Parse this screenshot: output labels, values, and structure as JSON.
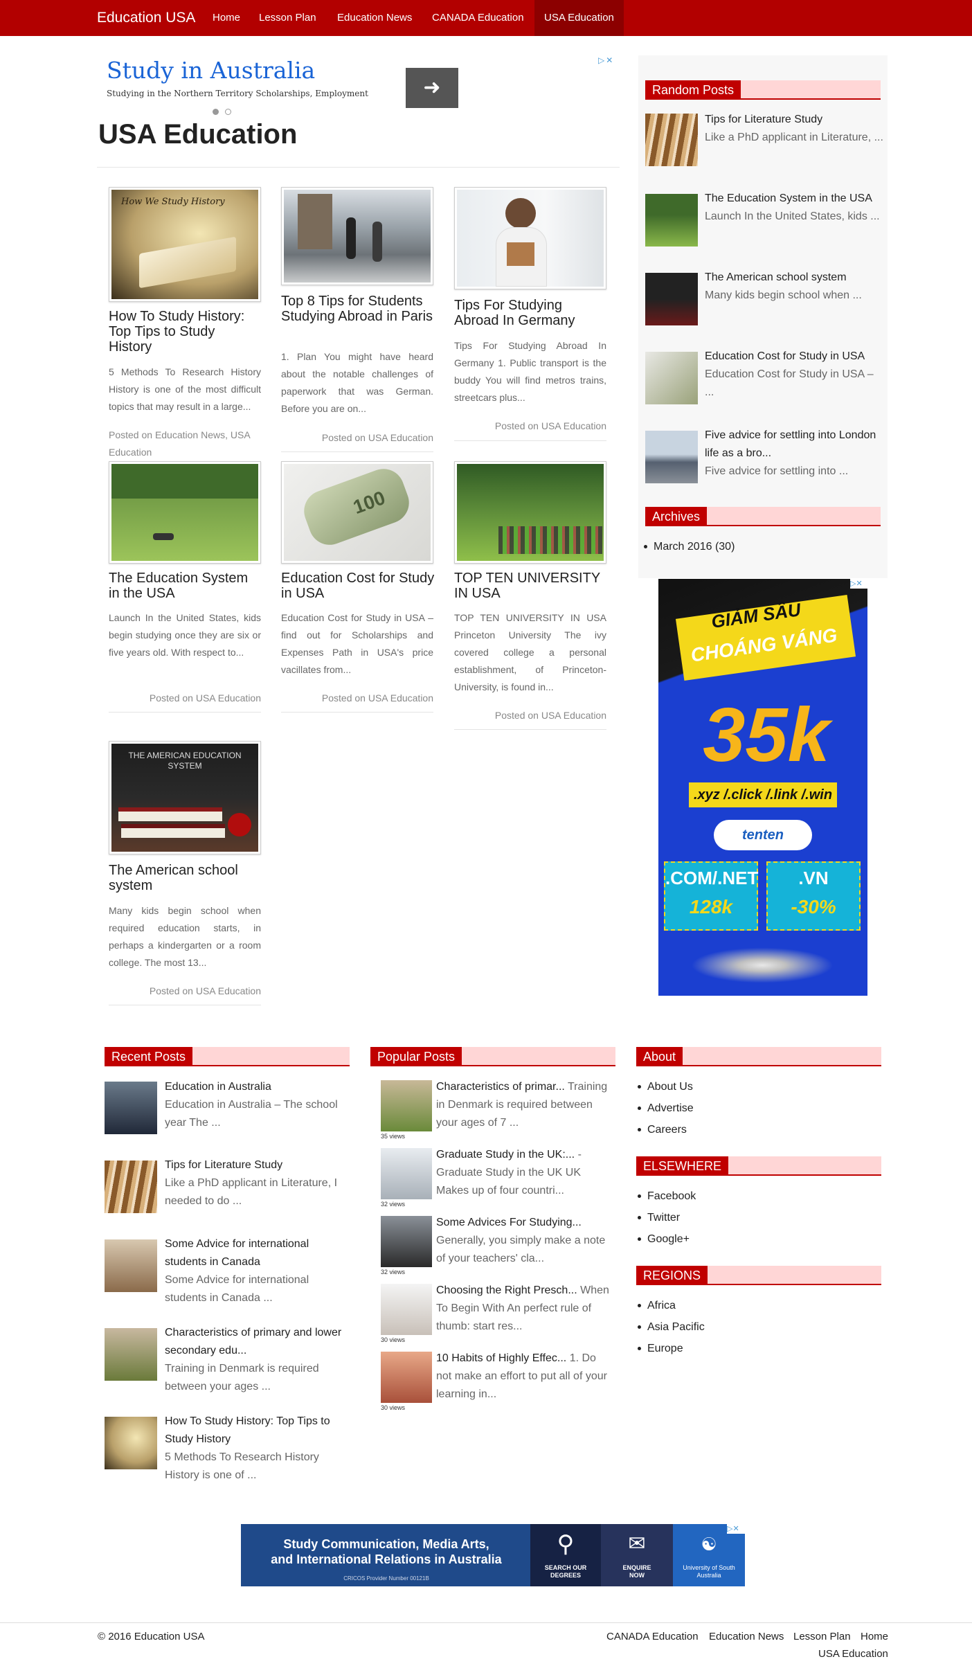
{
  "nav": {
    "brand": "Education USA",
    "items": [
      "Home",
      "Lesson Plan",
      "Education News",
      "CANADA Education",
      "USA Education"
    ],
    "active_index": 4
  },
  "ad_top": {
    "title": "Study in Australia",
    "subtitle": "Studying in the Northern Territory Scholarships, Employment",
    "button_icon": "arrow-right-icon",
    "adchoices_icon": "adchoices-close-icon"
  },
  "page_title": "USA Education",
  "posts": [
    {
      "title": "How To Study History: Top Tips to Study History",
      "excerpt": "5 Methods To Research History History is one of the most difficult topics that may result in a large...",
      "meta": "Posted on Education News, USA Education",
      "thumb_caption": "How We Study History"
    },
    {
      "title": "Top 8 Tips for Students Studying Abroad in Paris",
      "excerpt": "1. Plan You might have heard about the notable challenges of paperwork that was German. Before you are on...",
      "meta": "Posted on USA Education"
    },
    {
      "title": "Tips For Studying Abroad In Germany",
      "excerpt": "Tips For Studying Abroad In Germany 1. Public transport is the buddy You will find metros trains, streetcars plus...",
      "meta": "Posted on USA Education"
    },
    {
      "title": "The Education System in the USA",
      "excerpt": "Launch In the United States, kids begin studying once they are six or five years old. With respect to...",
      "meta": "Posted on USA Education"
    },
    {
      "title": "Education Cost for Study in USA",
      "excerpt": "Education Cost for Study in USA – find out for Scholarships and Expenses Path in USA's price vacillates from...",
      "meta": "Posted on USA Education"
    },
    {
      "title": "TOP TEN UNIVERSITY IN USA",
      "excerpt": "TOP TEN UNIVERSITY IN USA Princeton University The ivy covered college a personal establishment, of Princeton-University, is found in...",
      "meta": "Posted on USA Education"
    },
    {
      "title": "The American school system",
      "excerpt": "Many kids begin school when required education starts, in perhaps a kindergarten or a room college. The most 13...",
      "meta": "Posted on USA Education",
      "thumb_caption": "THE AMERICAN EDUCATION SYSTEM"
    }
  ],
  "sidebar": {
    "random_title": "Random Posts",
    "random_posts": [
      {
        "title": "Tips for Literature Study",
        "excerpt": "Like a PhD applicant in Literature, ..."
      },
      {
        "title": "The Education System in the USA",
        "excerpt": "Launch In the United States, kids ..."
      },
      {
        "title": "The American school system",
        "excerpt": "Many kids begin school when ..."
      },
      {
        "title": "Education Cost for Study in USA",
        "excerpt": "Education Cost for Study in USA – ..."
      },
      {
        "title": "Five advice for settling into London life as a bro...",
        "excerpt": "Five advice for settling into ..."
      }
    ],
    "archives_title": "Archives",
    "archives": [
      "March 2016 (30)"
    ]
  },
  "ad_right": {
    "headline_1": "GIẢM SÂU",
    "headline_2": "CHOÁNG VÁNG",
    "price": "35k",
    "tlds": ".xyz /.click /.link /.win",
    "brand": "tenten",
    "left_box_1": ".COM/.NET",
    "left_box_2": "128k",
    "right_box_1": ".VN",
    "right_box_2": "-30%"
  },
  "footer_widgets": {
    "recent_title": "Recent Posts",
    "recent": [
      {
        "title": "Education in Australia",
        "excerpt": "Education in Australia – The school year The ..."
      },
      {
        "title": "Tips for Literature Study",
        "excerpt": "Like a PhD applicant in Literature, I needed to do ..."
      },
      {
        "title": "Some Advice for international students in Canada",
        "excerpt": "Some Advice for international students in Canada ..."
      },
      {
        "title": "Characteristics of primary and lower secondary edu...",
        "excerpt": "Training in Denmark is required between your ages ..."
      },
      {
        "title": "How To Study History: Top Tips to Study History",
        "excerpt": "5 Methods To Research History History is one of ..."
      }
    ],
    "popular_title": "Popular Posts",
    "popular": [
      {
        "title": "Characteristics of primar...",
        "excerpt": "Training in Denmark is required between your ages of 7 ...",
        "views": "35 views"
      },
      {
        "title": "Graduate Study in the UK:...",
        "excerpt": "- Graduate Study in the UK UK Makes up of four countri...",
        "views": "32 views"
      },
      {
        "title": "Some Advices For Studying...",
        "excerpt": "Generally, you simply make a note of your teachers' cla...",
        "views": "32 views"
      },
      {
        "title": "Choosing the Right Presch...",
        "excerpt": "When To Begin With An perfect rule of thumb: start res...",
        "views": "30 views"
      },
      {
        "title": "10 Habits of Highly Effec...",
        "excerpt": "1. Do not make an effort to put all of your learning in...",
        "views": "30 views"
      }
    ],
    "about_title": "About",
    "about": [
      "About Us",
      "Advertise",
      "Careers"
    ],
    "elsewhere_title": "ELSEWHERE",
    "elsewhere": [
      "Facebook",
      "Twitter",
      "Google+"
    ],
    "regions_title": "REGIONS",
    "regions": [
      "Africa",
      "Asia Pacific",
      "Europe"
    ]
  },
  "ad_bottom": {
    "line1": "Study Communication, Media Arts,",
    "line2": "and International Relations in Australia",
    "provider": "CRICOS Provider Number 00121B",
    "btn1": "SEARCH OUR DEGREES",
    "btn2": "ENQUIRE NOW",
    "btn3": "University of South Australia"
  },
  "footer": {
    "copyright": "© 2016 Education USA",
    "links": [
      "CANADA Education",
      "Education News",
      "Lesson Plan",
      "Home",
      "USA Education"
    ]
  },
  "colors": {
    "brand_red": "#b20000",
    "widget_red": "#c00000",
    "widget_pink": "#ffd6d6",
    "ad_blue": "#1b3fd0"
  }
}
